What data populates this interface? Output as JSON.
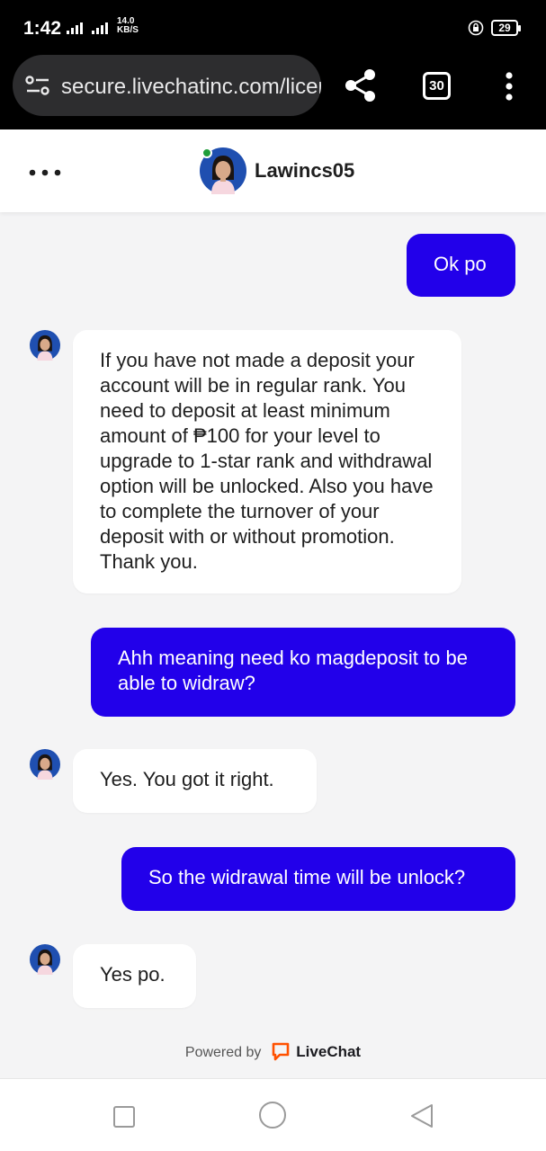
{
  "status_bar": {
    "time": "1:42",
    "signal": "4G",
    "speed_value": "14.0",
    "speed_unit": "KB/S",
    "battery": "29"
  },
  "browser": {
    "url": "secure.livechatinc.com/licence",
    "tab_count": "30"
  },
  "chat": {
    "agent_name": "Lawincs05",
    "messages": [
      {
        "direction": "outgoing",
        "text": "Ok po"
      },
      {
        "direction": "incoming",
        "text": "If you have not made a deposit your account will be in regular rank. You need to deposit at least minimum amount of ₱100 for your level to upgrade to 1-star rank and withdrawal option will be unlocked. Also you have to complete the turnover of your deposit with or without promotion. Thank you."
      },
      {
        "direction": "outgoing",
        "text": "Ahh meaning need ko magdeposit to be able to widraw?"
      },
      {
        "direction": "incoming",
        "text": "Yes. You got it right."
      },
      {
        "direction": "outgoing",
        "text": "So the widrawal time will be unlock?"
      },
      {
        "direction": "incoming",
        "text": "Yes po."
      }
    ]
  },
  "footer": {
    "powered_by": "Powered by",
    "brand": "LiveChat"
  },
  "colors": {
    "outgoing_bubble": "#2200ea",
    "incoming_bubble": "#ffffff",
    "chat_background": "#f4f4f5",
    "online_status": "#1f9d3a",
    "livechat_brand": "#ff5100"
  },
  "icons": {
    "status": [
      "signal-icon",
      "lock-rotation-icon",
      "battery-icon"
    ],
    "browser": [
      "site-settings-icon",
      "share-icon",
      "tabs-icon",
      "more-vert-icon"
    ],
    "header": [
      "more-horiz-icon",
      "agent-avatar"
    ],
    "nav": [
      "recents-icon",
      "home-icon",
      "back-icon"
    ]
  }
}
